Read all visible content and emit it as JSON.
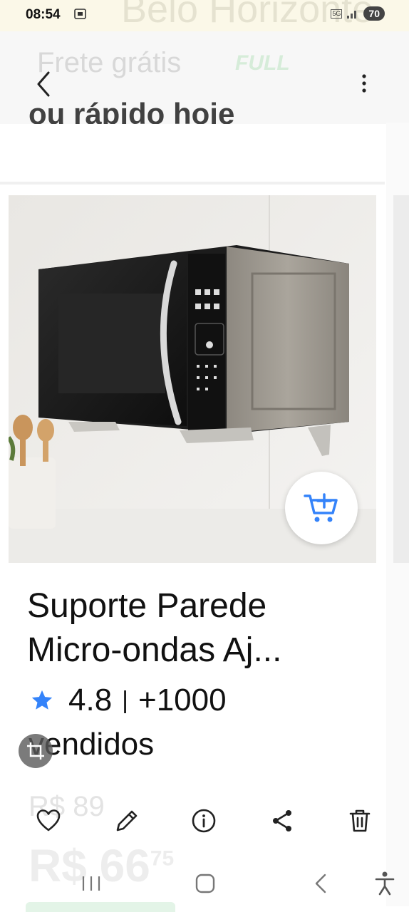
{
  "status_bar": {
    "time": "08:54",
    "network": "5G",
    "battery": "70"
  },
  "background_ghost": {
    "top_text": "Belo Horizonte",
    "shipping_label": "Frete grátis",
    "full_label": "FULL",
    "fast_label": "ou rápido hoje"
  },
  "product": {
    "title_line1": "Suporte Parede",
    "title_line2": "Micro-ondas Aj...",
    "rating": "4.8",
    "separator": "|",
    "sold_count": "+1000",
    "sold_label": "vendidos",
    "old_price": "R$ 89",
    "price": "R$ 66",
    "price_cents": "75"
  },
  "icons": {
    "back": "chevron-left-icon",
    "more": "more-vertical-icon",
    "cart": "add-to-cart-icon",
    "star": "star-icon",
    "favorite": "heart-icon",
    "edit": "pencil-icon",
    "info": "info-icon",
    "share": "share-icon",
    "delete": "trash-icon"
  },
  "colors": {
    "accent_blue": "#3483fa",
    "status_bg": "#fbf8e8"
  }
}
